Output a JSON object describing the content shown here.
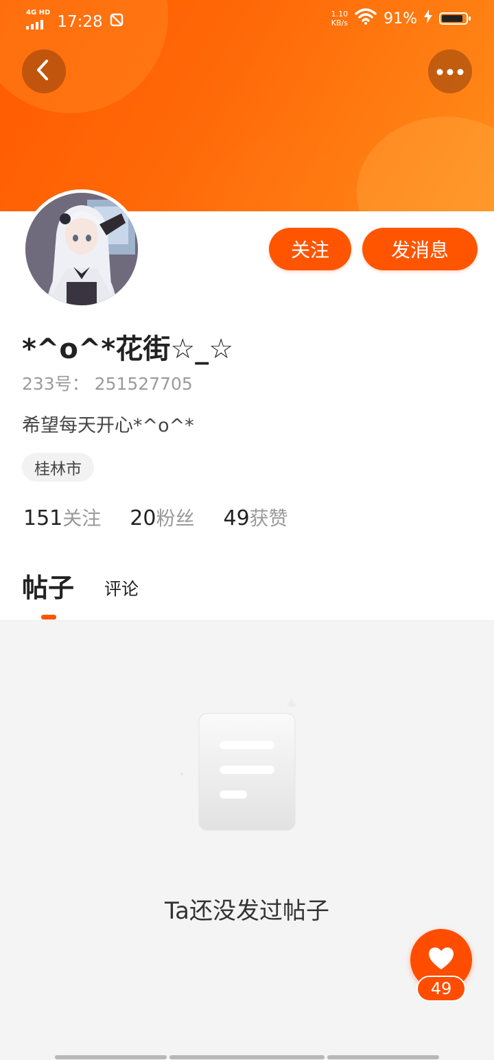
{
  "status_bar": {
    "network": "4G HD",
    "time": "17:28",
    "speed_value": "1.10",
    "speed_unit": "KB/s",
    "battery": "91%"
  },
  "header": {
    "back_icon": "chevron-left-icon",
    "more_icon": "more-dots-icon"
  },
  "profile": {
    "nickname": "*^o^*花街☆_☆",
    "id_line": "233号：  251527705",
    "bio": "希望每天开心*^o^*",
    "location": "桂林市"
  },
  "actions": {
    "follow_label": "关注",
    "message_label": "发消息"
  },
  "stats": [
    {
      "value": "151",
      "label": "关注"
    },
    {
      "value": "20",
      "label": "粉丝"
    },
    {
      "value": "49",
      "label": "获赞"
    }
  ],
  "tabs": [
    {
      "label": "帖子",
      "active": true
    },
    {
      "label": "评论",
      "active": false
    }
  ],
  "empty_state": {
    "icon": "empty-document-icon",
    "text": "Ta还没发过帖子"
  },
  "like_fab": {
    "icon": "heart-icon",
    "count": "49"
  },
  "colors": {
    "accent": "#ff5500",
    "header_gradient_start": "#ff5a00",
    "header_gradient_end": "#ff8c1a"
  }
}
